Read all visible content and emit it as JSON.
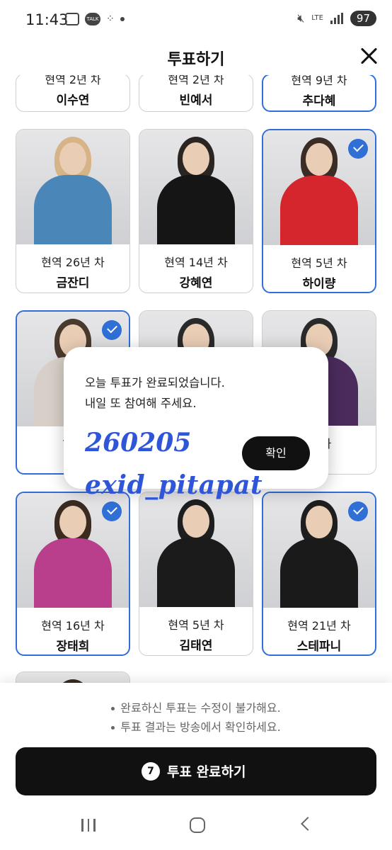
{
  "status_bar": {
    "time": "11:43",
    "talk_label": "TALK",
    "network": "LTE",
    "battery": "97"
  },
  "header": {
    "title": "투표하기"
  },
  "cards": [
    {
      "years": "현역 2년 차",
      "name": "이수연",
      "selected": false,
      "hair": "#c8a070",
      "outfit": "#bdbdbd"
    },
    {
      "years": "현역 2년 차",
      "name": "빈예서",
      "selected": false,
      "hair": "#2a2a2a",
      "outfit": "#777"
    },
    {
      "years": "현역 9년 차",
      "name": "추다혜",
      "selected": true,
      "hair": "#2a2a2a",
      "outfit": "#888"
    },
    {
      "years": "현역 26년 차",
      "name": "금잔디",
      "selected": false,
      "hair": "#d6b487",
      "outfit": "#4a86b8"
    },
    {
      "years": "현역 14년 차",
      "name": "강혜연",
      "selected": false,
      "hair": "#2b2522",
      "outfit": "#151515"
    },
    {
      "years": "현역 5년 차",
      "name": "하이량",
      "selected": true,
      "hair": "#3b2d26",
      "outfit": "#d4262c"
    },
    {
      "years": "현역",
      "name": "",
      "selected": true,
      "hair": "#4a3a2e",
      "outfit": "#d8d0c8"
    },
    {
      "years": "",
      "name": "",
      "selected": false,
      "hair": "#2a2a2a",
      "outfit": "#dcdcdc"
    },
    {
      "years": "년 차",
      "name": "",
      "selected": false,
      "hair": "#2a2a2a",
      "outfit": "#4b2b5c"
    },
    {
      "years": "현역 16년 차",
      "name": "장태희",
      "selected": true,
      "hair": "#3a2a20",
      "outfit": "#b93e8c"
    },
    {
      "years": "현역 5년 차",
      "name": "김태연",
      "selected": false,
      "hair": "#1e1e1e",
      "outfit": "#1b1b1b"
    },
    {
      "years": "현역 21년 차",
      "name": "스테파니",
      "selected": true,
      "hair": "#1e1e1e",
      "outfit": "#1a1a1a"
    },
    {
      "years": "",
      "name": "",
      "selected": false,
      "hair": "#3a2a20",
      "outfit": "#cccccc"
    }
  ],
  "dialog": {
    "message_line1": "오늘 투표가 완료되었습니다.",
    "message_line2": "내일 또 참여해 주세요.",
    "confirm_label": "확인"
  },
  "watermark": {
    "number": "260205",
    "handle": "exid_pitapat"
  },
  "bottom": {
    "notice1": "완료하신 투표는 수정이 불가해요.",
    "notice2": "투표 결과는 방송에서 확인하세요.",
    "selected_count": "7",
    "complete_label": "투표 완료하기"
  },
  "colors": {
    "accent": "#2f6fd6",
    "button": "#111111"
  }
}
